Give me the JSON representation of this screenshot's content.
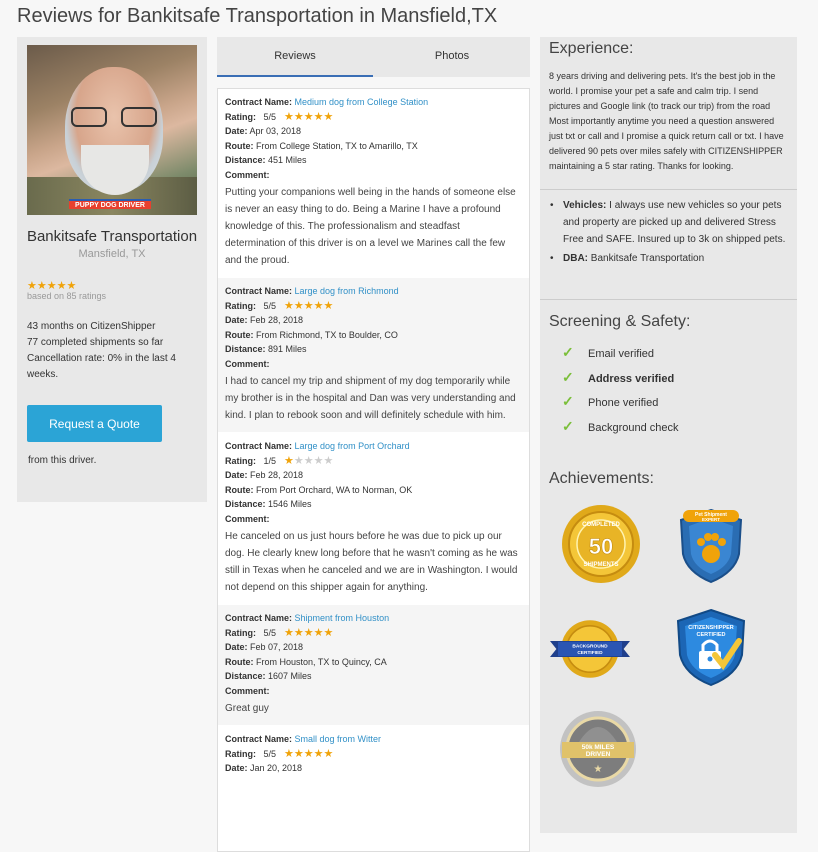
{
  "page": {
    "title": "Reviews for Bankitsafe Transportation in Mansfield,TX"
  },
  "profile": {
    "name": "Bankitsafe Transportation",
    "location": "Mansfield, TX",
    "stars": "★★★★★",
    "based_on": "based on 85 ratings",
    "months": "43 months on CitizenShipper",
    "shipments": "77 completed shipments so far",
    "cancellation": "Cancellation rate: 0% in the last 4 weeks.",
    "quote_button": "Request a Quote",
    "from_driver": "from this driver.",
    "avatar_badge": "PUPPY DOG DRIVER"
  },
  "tabs": {
    "reviews": "Reviews",
    "photos": "Photos"
  },
  "labels": {
    "contract": "Contract Name:",
    "rating": "Rating:",
    "date": "Date:",
    "route": "Route:",
    "distance": "Distance:",
    "comment": "Comment:"
  },
  "reviews": [
    {
      "contract": "Medium dog from College Station",
      "rating": "5/5",
      "stars": 5,
      "date": "Apr 03, 2018",
      "route": "From College Station, TX to Amarillo, TX",
      "distance": "451 Miles",
      "comment": "Putting your companions well being in the hands of someone else is never an easy thing to do. Being a Marine I have a profound knowledge of this. The professionalism and steadfast determination of this driver is on a level we Marines call the few and the proud."
    },
    {
      "contract": "Large dog from Richmond",
      "rating": "5/5",
      "stars": 5,
      "date": "Feb 28, 2018",
      "route": "From Richmond, TX to Boulder, CO",
      "distance": "891 Miles",
      "comment": "I had to cancel my trip and shipment of my dog temporarily while my brother is in the hospital and Dan was very understanding and kind. I plan to rebook soon and will definitely schedule with him."
    },
    {
      "contract": "Large dog from Port Orchard",
      "rating": "1/5",
      "stars": 1,
      "date": "Feb 28, 2018",
      "route": "From Port Orchard, WA to Norman, OK",
      "distance": "1546 Miles",
      "comment": "He canceled on us just hours before he was due to pick up our dog. He clearly knew long before that he wasn't coming as he was still in Texas when he canceled and we are in Washington. I would not depend on this shipper again for anything."
    },
    {
      "contract": "Shipment from Houston",
      "rating": "5/5",
      "stars": 5,
      "date": "Feb 07, 2018",
      "route": "From Houston, TX to Quincy, CA",
      "distance": "1607 Miles",
      "comment": "Great guy"
    },
    {
      "contract": "Small dog from Witter",
      "rating": "5/5",
      "stars": 5,
      "date": "Jan 20, 2018",
      "route": "",
      "distance": "",
      "comment": ""
    }
  ],
  "experience": {
    "title": "Experience:",
    "text": "8 years driving and delivering pets. It's the best job in the world. I promise your pet a safe and calm trip. I send pictures and Google link (to track our trip) from the road Most importantly anytime you need a question answered just txt or call and I promise a quick return call or txt. I have delivered 90 pets over miles safely with CITIZENSHIPPER maintaining a 5 star rating. Thanks for looking.",
    "vehicles_label": "Vehicles:",
    "vehicles_text": "I always use new vehicles so your pets and property are picked up and delivered Stress Free and SAFE. Insured up to 3k on shipped pets.",
    "dba_label": "DBA:",
    "dba_text": "Bankitsafe Transportation"
  },
  "screening": {
    "title": "Screening & Safety:",
    "items": [
      "Email verified",
      "Address verified",
      "Phone verified",
      "Background check"
    ]
  },
  "achievements": {
    "title": "Achievements:",
    "badges": [
      {
        "name": "completed-shipments-50",
        "line1": "COMPLETED",
        "big": "50",
        "line2": "SHIPMENTS"
      },
      {
        "name": "pet-shipment-expert",
        "line1": "Pet Shipment",
        "line2": "EXPERT"
      },
      {
        "name": "background-certified",
        "line1": "BACKGROUND",
        "line2": "CERTIFIED"
      },
      {
        "name": "citizenshipper-certified",
        "line1": "CITIZENSHIPPER",
        "line2": "CERTIFIED"
      },
      {
        "name": "50k-miles-driven",
        "line1": "50k MILES",
        "line2": "DRIVEN"
      }
    ]
  },
  "colors": {
    "accent": "#2ba4d6",
    "link": "#3190c7",
    "star": "#f0a30a",
    "check": "#7bbf3a",
    "tab_underline": "#3a6eb5"
  }
}
